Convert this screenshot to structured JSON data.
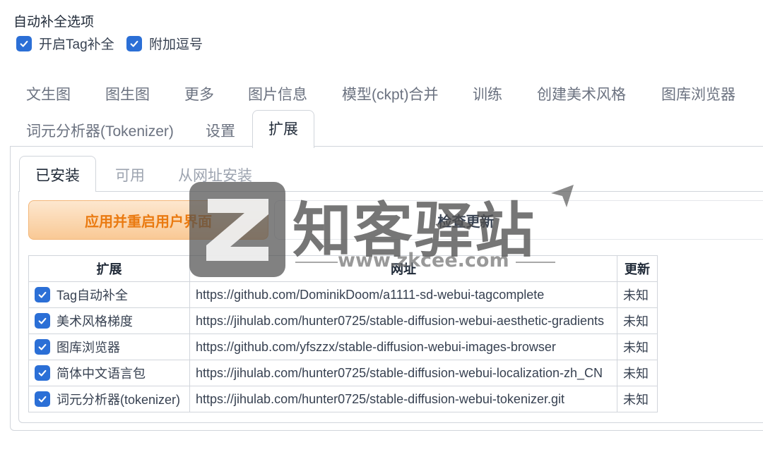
{
  "autocomplete": {
    "title": "自动补全选项",
    "options": [
      {
        "label": "开启Tag补全",
        "checked": true
      },
      {
        "label": "附加逗号",
        "checked": true
      }
    ]
  },
  "main_tabs": [
    {
      "label": "文生图",
      "active": false
    },
    {
      "label": "图生图",
      "active": false
    },
    {
      "label": "更多",
      "active": false
    },
    {
      "label": "图片信息",
      "active": false
    },
    {
      "label": "模型(ckpt)合并",
      "active": false
    },
    {
      "label": "训练",
      "active": false
    },
    {
      "label": "创建美术风格",
      "active": false
    },
    {
      "label": "图库浏览器",
      "active": false
    },
    {
      "label": "词元分析器(Tokenizer)",
      "active": false
    },
    {
      "label": "设置",
      "active": false
    },
    {
      "label": "扩展",
      "active": true
    }
  ],
  "ext_tabs": [
    {
      "label": "已安装",
      "active": true
    },
    {
      "label": "可用",
      "active": false
    },
    {
      "label": "从网址安装",
      "active": false
    }
  ],
  "buttons": {
    "apply": "应用并重启用户界面",
    "check": "检查更新"
  },
  "table": {
    "headers": [
      "扩展",
      "网址",
      "更新"
    ],
    "rows": [
      {
        "name": "Tag自动补全",
        "url": "https://github.com/DominikDoom/a1111-sd-webui-tagcomplete",
        "update": "未知",
        "checked": true
      },
      {
        "name": "美术风格梯度",
        "url": "https://jihulab.com/hunter0725/stable-diffusion-webui-aesthetic-gradients",
        "update": "未知",
        "checked": true
      },
      {
        "name": "图库浏览器",
        "url": "https://github.com/yfszzx/stable-diffusion-webui-images-browser",
        "update": "未知",
        "checked": true
      },
      {
        "name": "简体中文语言包",
        "url": "https://jihulab.com/hunter0725/stable-diffusion-webui-localization-zh_CN",
        "update": "未知",
        "checked": true
      },
      {
        "name": "词元分析器(tokenizer)",
        "url": "https://jihulab.com/hunter0725/stable-diffusion-webui-tokenizer.git",
        "update": "未知",
        "checked": true
      }
    ]
  },
  "watermark": {
    "text": "知客驿站",
    "url": "www.zkcee.com"
  },
  "colors": {
    "checkbox": "#2b6fd6",
    "apply_text": "#ea7a10",
    "apply_bg": "#f9c995"
  }
}
